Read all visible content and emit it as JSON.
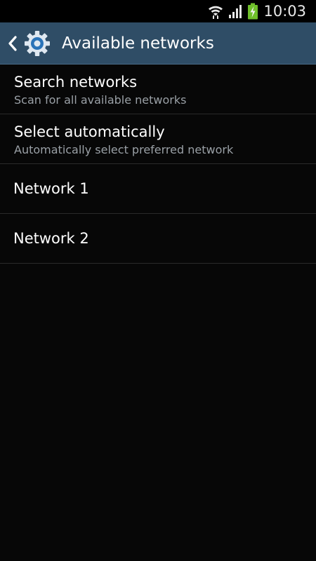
{
  "status_bar": {
    "time": "10:03",
    "icons": [
      "wifi-icon",
      "signal-icon",
      "battery-charging-icon"
    ]
  },
  "action_bar": {
    "title": "Available networks",
    "back_icon": "chevron-left-icon",
    "app_icon": "gear-icon"
  },
  "list": {
    "items": [
      {
        "title": "Search networks",
        "subtitle": "Scan for all available networks"
      },
      {
        "title": "Select automatically",
        "subtitle": "Automatically select preferred network"
      },
      {
        "title": "Network 1"
      },
      {
        "title": "Network 2"
      }
    ]
  },
  "colors": {
    "background": "#070707",
    "action_bar": "#2f4d66",
    "battery_green": "#6fbf2a",
    "text_primary": "#ffffff",
    "text_secondary": "#9aa0a6",
    "divider": "#2a2a2a"
  }
}
